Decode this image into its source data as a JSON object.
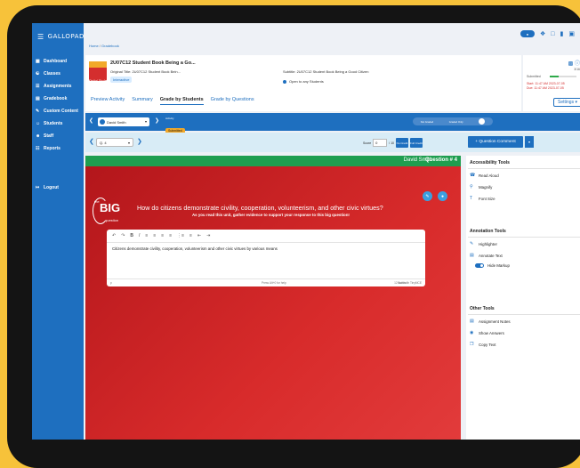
{
  "brand": {
    "name": "GALLOPADE"
  },
  "sidebar": {
    "items": [
      {
        "label": "Dashboard",
        "icon": "dashboard-icon"
      },
      {
        "label": "Classes",
        "icon": "classes-icon"
      },
      {
        "label": "Assignments",
        "icon": "assignments-icon"
      },
      {
        "label": "Gradebook",
        "icon": "gradebook-icon"
      },
      {
        "label": "Custom Content",
        "icon": "custom-content-icon"
      },
      {
        "label": "Students",
        "icon": "students-icon"
      },
      {
        "label": "Staff",
        "icon": "staff-icon"
      },
      {
        "label": "Reports",
        "icon": "reports-icon"
      },
      {
        "label": "Logout",
        "icon": "logout-icon"
      }
    ]
  },
  "breadcrumb": {
    "home": "Home",
    "sep": "/",
    "current": "Gradebook"
  },
  "header": {
    "title": "2U07C12 Student Book Being a Go...",
    "original_title": "Original Title: 2U07C12 Student Book Bein...",
    "badge": "Interactive",
    "book_label": "Digital Student Book",
    "subtitle": "Subtitle: 2U07C12 Student Book Being a Good Citizen",
    "open_label": "Open to any Students",
    "tabs": [
      "Preview Activity",
      "Summary",
      "Grade by Students",
      "Grade by Questions"
    ],
    "active_tab": "Grade by Students"
  },
  "assign_info": {
    "count": "3/16",
    "submitted_label": "Submitted",
    "progress": 0.33,
    "start": "Start: 11:47 AM 2023-07-05",
    "due": "Due: 11:47 AM 2023-07-05",
    "settings_label": "Settings"
  },
  "student_bar": {
    "student": "David Smith",
    "status_label": "Activity",
    "status": "Submitted",
    "toggle_left": "Not Graded",
    "toggle_right": "Graded Only"
  },
  "question_bar": {
    "question": "Q. 4",
    "score_label": "Score",
    "score_value": "0",
    "score_max": "/ 10",
    "no_credit": "No Credit",
    "full_credit": "Full Credit",
    "comment": "+ Question Comment"
  },
  "question_header": {
    "student": "David Smith",
    "question_number": "Question # 4"
  },
  "question": {
    "logo_the": "the",
    "logo_big": "BIG",
    "logo_q": "question",
    "text": "How do citizens demonstrate civility, cooperation, volunteerism, and other civic virtues?",
    "instruction": "As you read this unit, gather evidence to support your response to this big question!"
  },
  "editor": {
    "answer": "Citizens demonstrate civility, cooperation, volunteerism and other civic virtues by various means",
    "status_p": "p",
    "status_help": "Press Alt+0 for help",
    "word_count": "12 words",
    "built_with": "Built with TinyMCE"
  },
  "tools": {
    "accessibility_title": "Accessibility Tools",
    "accessibility": [
      "Read Aloud",
      "Magnify",
      "Font Size"
    ],
    "annotation_title": "Annotation Tools",
    "annotation": [
      "Highlighter",
      "Annotate Text",
      "Hide Markup"
    ],
    "other_title": "Other Tools",
    "other": [
      "Assignment Notes",
      "Show Answers",
      "Copy Text"
    ]
  },
  "colors": {
    "primary": "#1e6fbf",
    "success": "#1f9e4f",
    "question_bg": "#d82b2b",
    "accent": "#f2a92a"
  }
}
